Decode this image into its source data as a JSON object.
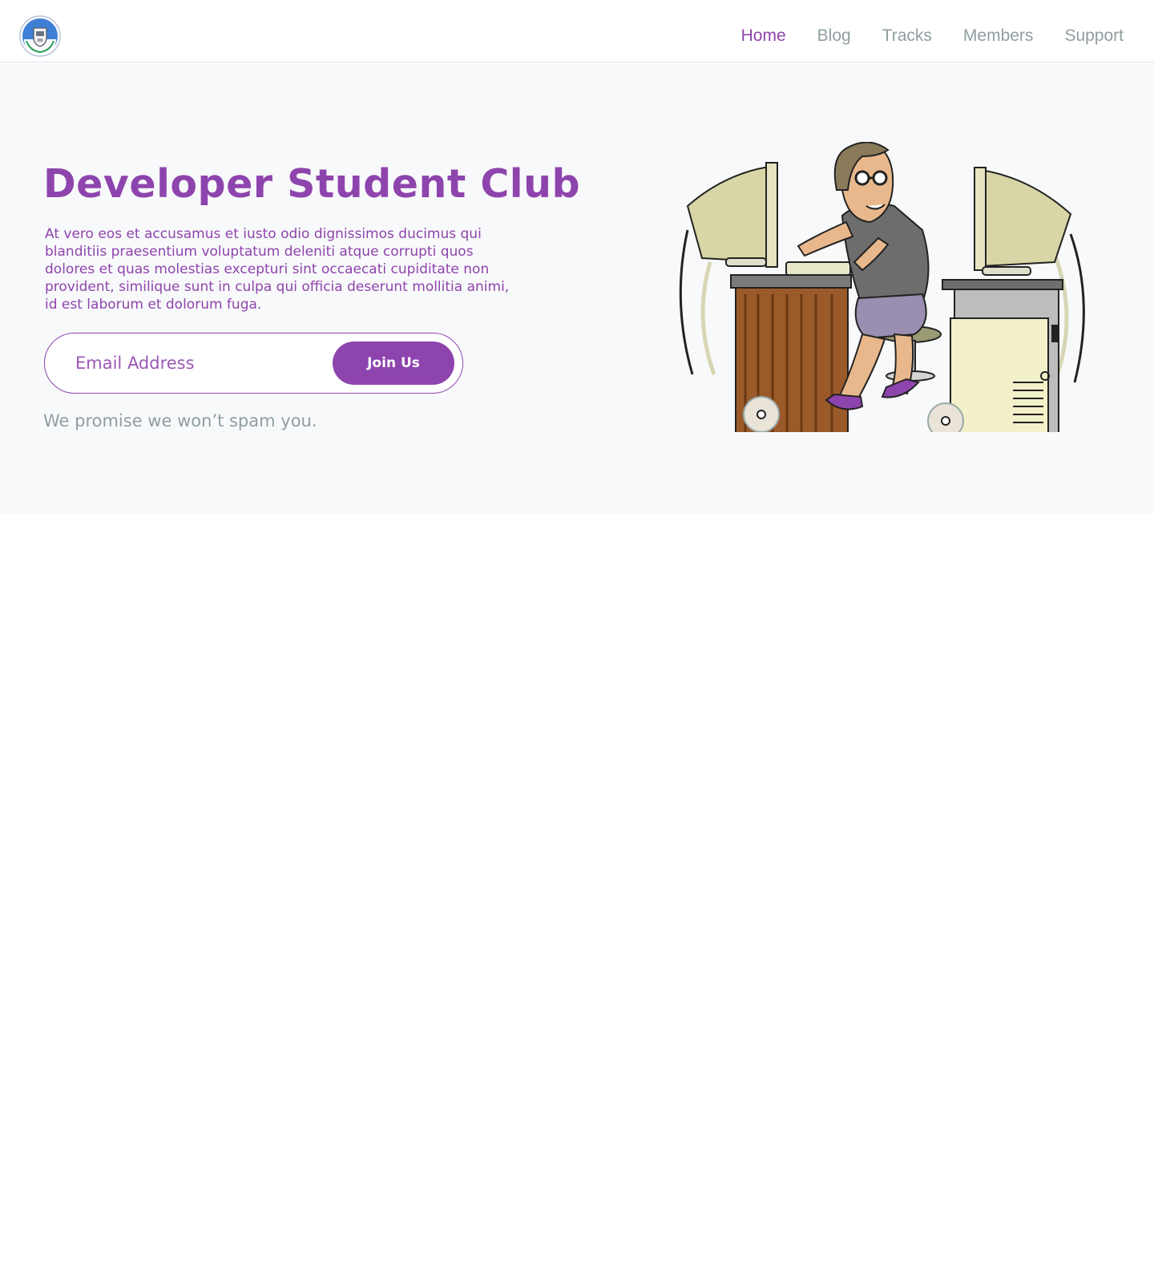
{
  "navbar": {
    "logo_icon": "club-logo-icon",
    "links": [
      {
        "label": "Home",
        "active": true
      },
      {
        "label": "Blog",
        "active": false
      },
      {
        "label": "Tracks",
        "active": false
      },
      {
        "label": "Members",
        "active": false
      },
      {
        "label": "Support",
        "active": false
      }
    ]
  },
  "hero": {
    "title": "Developer Student Club",
    "description": "At vero eos et accusamus et iusto odio dignissimos ducimus qui blanditiis praesentium voluptatum deleniti atque corrupti quos dolores et quas molestias excepturi sint occaecati cupiditate non provident, similique sunt in culpa qui officia deserunt mollitia animi, id est laborum et dolorum fuga.",
    "email_placeholder": "Email Address",
    "join_label": "Join Us",
    "note": "We promise we won’t spam you.",
    "illustration_icon": "developer-at-computers-illustration"
  },
  "colors": {
    "accent": "#8e44ad",
    "muted": "#8f9ea0",
    "hero_bg": "#f8f9fa"
  }
}
